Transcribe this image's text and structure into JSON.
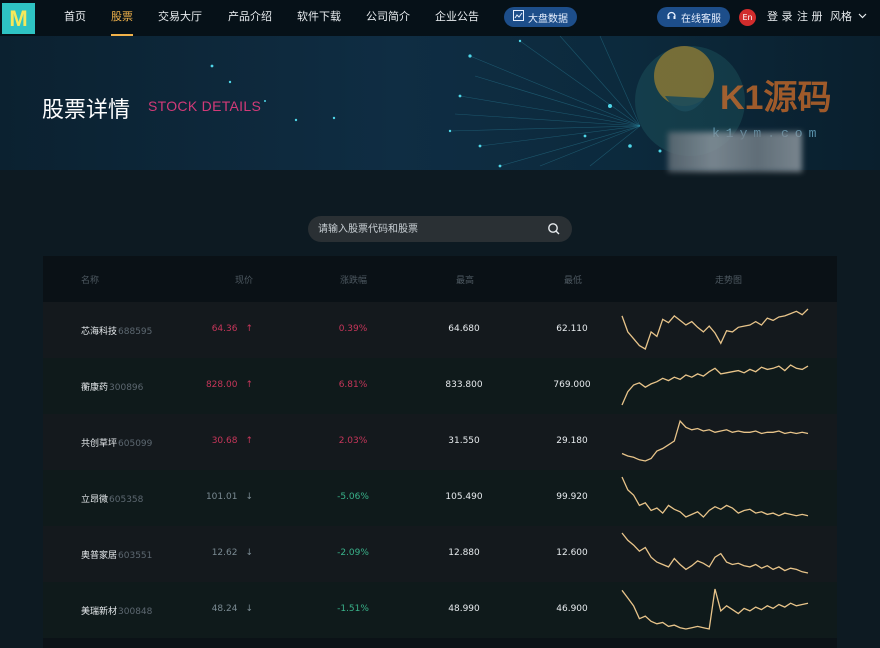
{
  "nav": {
    "logo": "M",
    "items": [
      "首页",
      "股票",
      "交易大厅",
      "产品介绍",
      "软件下载",
      "公司简介",
      "企业公告"
    ],
    "active_index": 1,
    "market_btn": "大盘数据",
    "service_btn": "在线客服",
    "lang": "En",
    "login": "登 录",
    "register": "注 册",
    "style": "风格"
  },
  "banner": {
    "title": "股票详情",
    "subtitle": "STOCK DETAILS",
    "watermark": "K1源码",
    "watermark_sub": "k1ym.com"
  },
  "search": {
    "placeholder": "请输入股票代码和股票"
  },
  "table": {
    "headers": [
      "名称",
      "现价",
      "涨跌幅",
      "最高",
      "最低",
      "走势图"
    ],
    "rows": [
      {
        "name": "芯海科技",
        "code": "688595",
        "price": "64.36",
        "dir": "up",
        "change": "0.39%",
        "high": "64.680",
        "low": "62.110",
        "trend": [
          3.0,
          1.6,
          1.0,
          0.4,
          0.1,
          1.6,
          1.2,
          2.7,
          2.4,
          3.0,
          2.6,
          2.2,
          2.5,
          2.0,
          1.6,
          2.1,
          1.5,
          0.6,
          1.7,
          1.6,
          2.0,
          2.1,
          2.2,
          2.5,
          2.2,
          2.8,
          2.6,
          2.9,
          3.0,
          3.2,
          3.4,
          3.1,
          3.6
        ]
      },
      {
        "name": "蘅康药",
        "code": "300896",
        "price": "828.00",
        "dir": "up",
        "change": "6.81%",
        "high": "833.800",
        "low": "769.000",
        "trend": [
          0.0,
          1.2,
          1.8,
          2.0,
          1.6,
          1.9,
          2.1,
          2.4,
          2.2,
          2.5,
          2.3,
          2.7,
          2.5,
          2.8,
          2.6,
          3.0,
          3.3,
          2.8,
          2.9,
          3.0,
          3.1,
          2.9,
          3.2,
          3.0,
          3.4,
          3.2,
          3.3,
          3.5,
          3.1,
          3.6,
          3.3,
          3.2,
          3.5
        ]
      },
      {
        "name": "共创草坪",
        "code": "605099",
        "price": "30.68",
        "dir": "up",
        "change": "2.03%",
        "high": "31.550",
        "low": "29.180",
        "trend": [
          0.6,
          0.4,
          0.3,
          0.1,
          0.0,
          0.2,
          0.8,
          1.0,
          1.3,
          1.6,
          3.2,
          2.7,
          2.5,
          2.6,
          2.4,
          2.5,
          2.3,
          2.4,
          2.5,
          2.3,
          2.4,
          2.3,
          2.3,
          2.4,
          2.2,
          2.3,
          2.3,
          2.4,
          2.2,
          2.3,
          2.2,
          2.3,
          2.2
        ]
      },
      {
        "name": "立昂微",
        "code": "605358",
        "price": "101.01",
        "dir": "down",
        "change": "-5.06%",
        "high": "105.490",
        "low": "99.920",
        "trend": [
          3.6,
          2.6,
          2.2,
          1.4,
          1.6,
          1.0,
          1.2,
          0.8,
          1.4,
          1.1,
          0.9,
          0.5,
          0.7,
          0.9,
          0.5,
          1.0,
          1.3,
          1.1,
          1.4,
          1.2,
          0.8,
          1.0,
          1.1,
          0.8,
          0.9,
          0.7,
          0.8,
          0.6,
          0.8,
          0.7,
          0.6,
          0.7,
          0.6
        ]
      },
      {
        "name": "奥普家居",
        "code": "603551",
        "price": "12.62",
        "dir": "down",
        "change": "-2.09%",
        "high": "12.880",
        "low": "12.600",
        "trend": [
          3.6,
          3.0,
          2.6,
          2.1,
          2.4,
          1.6,
          1.2,
          1.0,
          0.8,
          1.5,
          1.0,
          0.6,
          0.9,
          1.3,
          1.1,
          0.8,
          1.6,
          1.9,
          1.2,
          1.0,
          1.1,
          0.9,
          0.8,
          1.0,
          0.7,
          0.9,
          0.6,
          0.8,
          0.5,
          0.7,
          0.6,
          0.4,
          0.3
        ]
      },
      {
        "name": "美瑞新材",
        "code": "300848",
        "price": "48.24",
        "dir": "down",
        "change": "-1.51%",
        "high": "48.990",
        "low": "46.900",
        "trend": [
          3.4,
          2.8,
          2.2,
          1.2,
          1.4,
          1.0,
          0.8,
          0.9,
          0.6,
          0.7,
          0.5,
          0.4,
          0.5,
          0.6,
          0.5,
          0.4,
          3.5,
          1.8,
          2.2,
          1.9,
          1.6,
          2.0,
          1.8,
          2.1,
          1.9,
          2.2,
          2.0,
          2.3,
          2.1,
          2.4,
          2.2,
          2.3,
          2.4
        ]
      }
    ]
  },
  "colors": {
    "accent": "#f1b24a",
    "up": "#c6365a",
    "down_change": "#39b28a",
    "trend_line": "#e8c48a"
  },
  "icons": [
    "chart-icon",
    "headset-icon",
    "chevron-down-icon",
    "search-icon"
  ]
}
